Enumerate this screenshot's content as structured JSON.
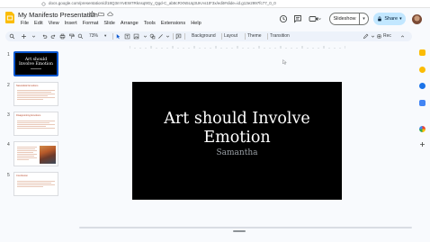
{
  "browser": {
    "url": "docs.google.com/presentation/d/18Q3mYvEW7Rknsq9Gy_Qgd-C_ab8cRXN5Uq3UKAs1tF3x/edit#slide=id.g13e2997fc77_0_0"
  },
  "app": {
    "title": "My Manifesto Presentation",
    "menus": [
      "File",
      "Edit",
      "View",
      "Insert",
      "Format",
      "Slide",
      "Arrange",
      "Tools",
      "Extensions",
      "Help"
    ]
  },
  "header": {
    "slideshow_label": "Slideshow",
    "share_label": "Share"
  },
  "toolbar": {
    "zoom": "73%",
    "background_label": "Background",
    "layout_label": "Layout",
    "theme_label": "Theme",
    "transition_label": "Transition",
    "rec_label": "Rec"
  },
  "filmstrip": {
    "slides": [
      {
        "num": "1",
        "title": "Art should Involve Emotion"
      },
      {
        "num": "2",
        "title": "Naturalistic Emotions"
      },
      {
        "num": "3",
        "title": "Disappointing Emotions"
      },
      {
        "num": "4",
        "title": ""
      },
      {
        "num": "5",
        "title": "Conclusion"
      }
    ]
  },
  "slide": {
    "title_line1": "Art should Involve",
    "title_line2": "Emotion",
    "subtitle": "Samantha",
    "background": "#000000",
    "title_color": "#ffffff",
    "subtitle_color": "#9aa0a6"
  },
  "colors": {
    "accent": "#0b57d0",
    "share_bg": "#c2e7ff",
    "toolbar_bg": "#edf2fa"
  }
}
